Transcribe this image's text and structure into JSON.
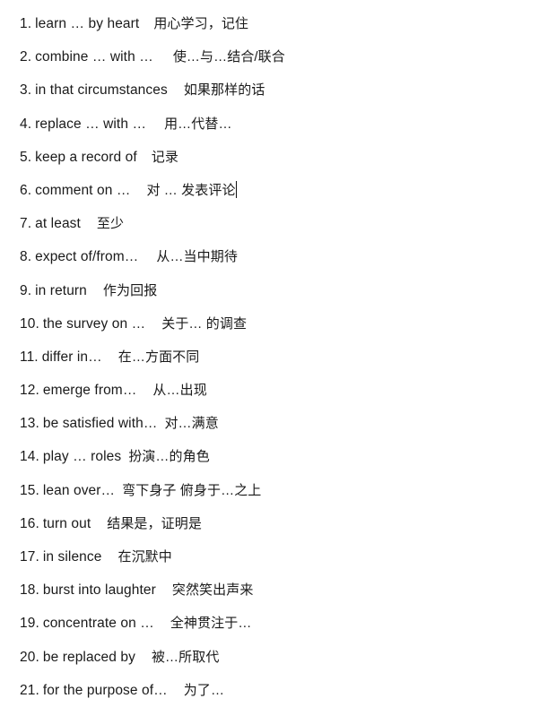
{
  "document": {
    "type": "vocabulary-phrase-list",
    "background_color": "#ffffff",
    "text_color": "#1a1a1a",
    "caret_color": "#111111",
    "caret_after_entry": 6,
    "entries": [
      {
        "index": "1.",
        "english": "learn … by heart",
        "gap": 16,
        "chinese": "用心学习，记住"
      },
      {
        "index": "2.",
        "english": "combine … with …",
        "gap": 22,
        "chinese": "使…与…结合/联合"
      },
      {
        "index": "3.",
        "english": "in that circumstances",
        "gap": 18,
        "chinese": "如果那样的话"
      },
      {
        "index": "4.",
        "english": "replace … with …",
        "gap": 20,
        "chinese": "用…代替…"
      },
      {
        "index": "5.",
        "english": "keep a record of",
        "gap": 16,
        "chinese": "记录"
      },
      {
        "index": "6.",
        "english": "comment on …",
        "gap": 18,
        "chinese": "对 … 发表评论"
      },
      {
        "index": "7.",
        "english": "at least",
        "gap": 18,
        "chinese": "至少"
      },
      {
        "index": "8.",
        "english": "expect of/from…",
        "gap": 20,
        "chinese": "从…当中期待"
      },
      {
        "index": "9.",
        "english": "in return",
        "gap": 18,
        "chinese": "作为回报"
      },
      {
        "index": "10.",
        "english": "the survey on …",
        "gap": 18,
        "chinese": "关于… 的调查"
      },
      {
        "index": "11.",
        "english": "differ in…",
        "gap": 18,
        "chinese": "在…方面不同"
      },
      {
        "index": "12.",
        "english": "emerge from…",
        "gap": 18,
        "chinese": "从…出现"
      },
      {
        "index": "13.",
        "english": "be satisfied with…",
        "gap": 8,
        "chinese": "对…满意"
      },
      {
        "index": "14.",
        "english": "play … roles",
        "gap": 8,
        "chinese": "扮演…的角色"
      },
      {
        "index": "15.",
        "english": "lean over…",
        "gap": 8,
        "chinese": "弯下身子 俯身于…之上"
      },
      {
        "index": "16.",
        "english": "turn out",
        "gap": 18,
        "chinese": "结果是，证明是"
      },
      {
        "index": "17.",
        "english": "in silence",
        "gap": 18,
        "chinese": "在沉默中"
      },
      {
        "index": "18.",
        "english": "burst into laughter",
        "gap": 18,
        "chinese": "突然笑出声来"
      },
      {
        "index": "19.",
        "english": "concentrate on …",
        "gap": 18,
        "chinese": "全神贯注于…"
      },
      {
        "index": "20.",
        "english": "be replaced by",
        "gap": 18,
        "chinese": "被…所取代"
      },
      {
        "index": "21.",
        "english": "for the purpose of…",
        "gap": 18,
        "chinese": "为了…"
      }
    ]
  }
}
